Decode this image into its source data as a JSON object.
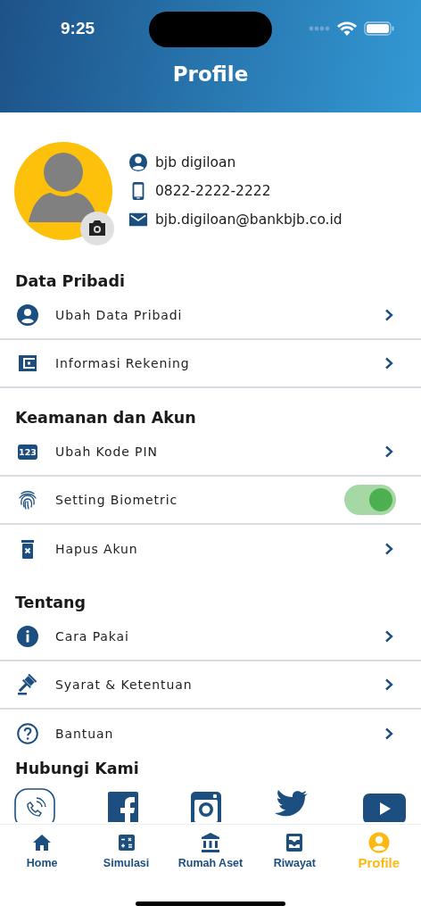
{
  "status_bar": {
    "time": "9:25"
  },
  "header": {
    "title": "Profile"
  },
  "profile": {
    "name": "bjb digiloan",
    "phone": "0822-2222-2222",
    "email": "bjb.digiloan@bankbjb.co.id"
  },
  "sections": [
    {
      "title": "Data Pribadi",
      "items": [
        {
          "kind": "link",
          "label": "Ubah Data Pribadi",
          "divider": true
        },
        {
          "kind": "link",
          "label": "Informasi Rekening",
          "divider": true
        }
      ]
    },
    {
      "title": "Keamanan dan Akun",
      "items": [
        {
          "kind": "link",
          "label": "Ubah Kode PIN",
          "icon_text": "123",
          "divider": true
        },
        {
          "kind": "toggle",
          "label": "Setting Biometric",
          "on": true,
          "divider": true
        },
        {
          "kind": "link",
          "label": "Hapus Akun",
          "divider": false
        }
      ]
    },
    {
      "title": "Tentang",
      "items": [
        {
          "kind": "link",
          "label": "Cara Pakai",
          "divider": true
        },
        {
          "kind": "link",
          "label": "Syarat & Ketentuan",
          "divider": true
        },
        {
          "kind": "link",
          "label": "Bantuan",
          "divider": false
        }
      ]
    }
  ],
  "contact": {
    "title": "Hubungi Kami"
  },
  "nav": [
    {
      "label": "Home",
      "selected": false
    },
    {
      "label": "Simulasi",
      "selected": false
    },
    {
      "label": "Rumah Aset",
      "selected": false
    },
    {
      "label": "Riwayat",
      "selected": false
    },
    {
      "label": "Profile",
      "selected": true
    }
  ]
}
